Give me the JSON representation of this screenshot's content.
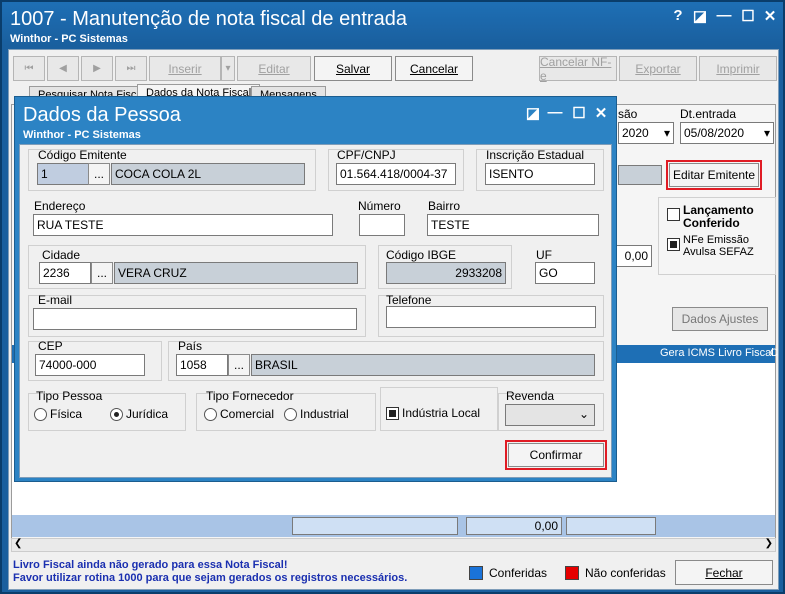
{
  "main_window": {
    "title": "1007 - Manutenção de nota fiscal de entrada",
    "subtitle": "Winthor - PC Sistemas",
    "controls": {
      "help": "?",
      "restore": "◪",
      "minimize": "—",
      "maximize": "☐",
      "close": "✕"
    }
  },
  "toolbar": {
    "nav_first": "⏮",
    "nav_prev": "◀",
    "nav_next": "▶",
    "nav_last": "⏭",
    "inserir": "Inserir",
    "editar": "Editar",
    "salvar": "Salvar",
    "cancelar": "Cancelar",
    "cancelar_nfe": "Cancelar NF-e",
    "exportar": "Exportar",
    "imprimir": "Imprimir"
  },
  "tabs": [
    {
      "label": "Pesquisar Nota Fiscal"
    },
    {
      "label": "Dados da Nota Fiscal"
    },
    {
      "label": "Mensagens"
    }
  ],
  "background_form": {
    "emissao_label": "são",
    "emissao_value": "2020",
    "dt_entrada_label": "Dt.entrada",
    "dt_entrada_value": "05/08/2020",
    "editar_emitente": "Editar Emitente",
    "lancamento_conferido": "Lançamento Conferido",
    "nfe_emissao": "NFe Emissão Avulsa SEFAZ",
    "value_field": "0,00",
    "dados_ajustes": "Dados Ajustes",
    "grid_header": "Gera ICMS Livro Fiscal",
    "grid_header_cut": "C",
    "total_value": "0,00"
  },
  "status": {
    "line1": "Livro Fiscal ainda não gerado para essa Nota Fiscal!",
    "line2": "Favor utilizar rotina 1000 para que sejam gerados os registros necessários.",
    "legend_conferidas": "Conferidas",
    "legend_nao_conferidas": "Não conferidas",
    "fechar": "Fechar",
    "colors": {
      "conferidas": "#1a73d9",
      "nao_conferidas": "#e60000"
    }
  },
  "dialog": {
    "title": "Dados da Pessoa",
    "subtitle": "Winthor - PC Sistemas",
    "codigo_emitente_label": "Código Emitente",
    "codigo_emitente_value": "1",
    "emitente_nome": "COCA COLA 2L",
    "cpf_cnpj_label": "CPF/CNPJ",
    "cpf_cnpj_value": "01.564.418/0004-37",
    "inscricao_label": "Inscrição Estadual",
    "inscricao_value": "ISENTO",
    "endereco_label": "Endereço",
    "endereco_value": "RUA TESTE",
    "numero_label": "Número",
    "numero_value": "",
    "bairro_label": "Bairro",
    "bairro_value": "TESTE",
    "cidade_label": "Cidade",
    "cidade_codigo": "2236",
    "cidade_nome": "VERA CRUZ",
    "ibge_label": "Código IBGE",
    "ibge_value": "2933208",
    "uf_label": "UF",
    "uf_value": "GO",
    "email_label": "E-mail",
    "email_value": "",
    "telefone_label": "Telefone",
    "telefone_value": "",
    "cep_label": "CEP",
    "cep_value": "74000-000",
    "pais_label": "País",
    "pais_codigo": "1058",
    "pais_nome": "BRASIL",
    "tipo_pessoa_label": "Tipo Pessoa",
    "fisica": "Física",
    "juridica": "Jurídica",
    "tipo_fornecedor_label": "Tipo Fornecedor",
    "comercial": "Comercial",
    "industrial": "Industrial",
    "industria_local": "Indústria Local",
    "revenda_label": "Revenda",
    "ellipsis": "...",
    "confirmar": "Confirmar"
  }
}
